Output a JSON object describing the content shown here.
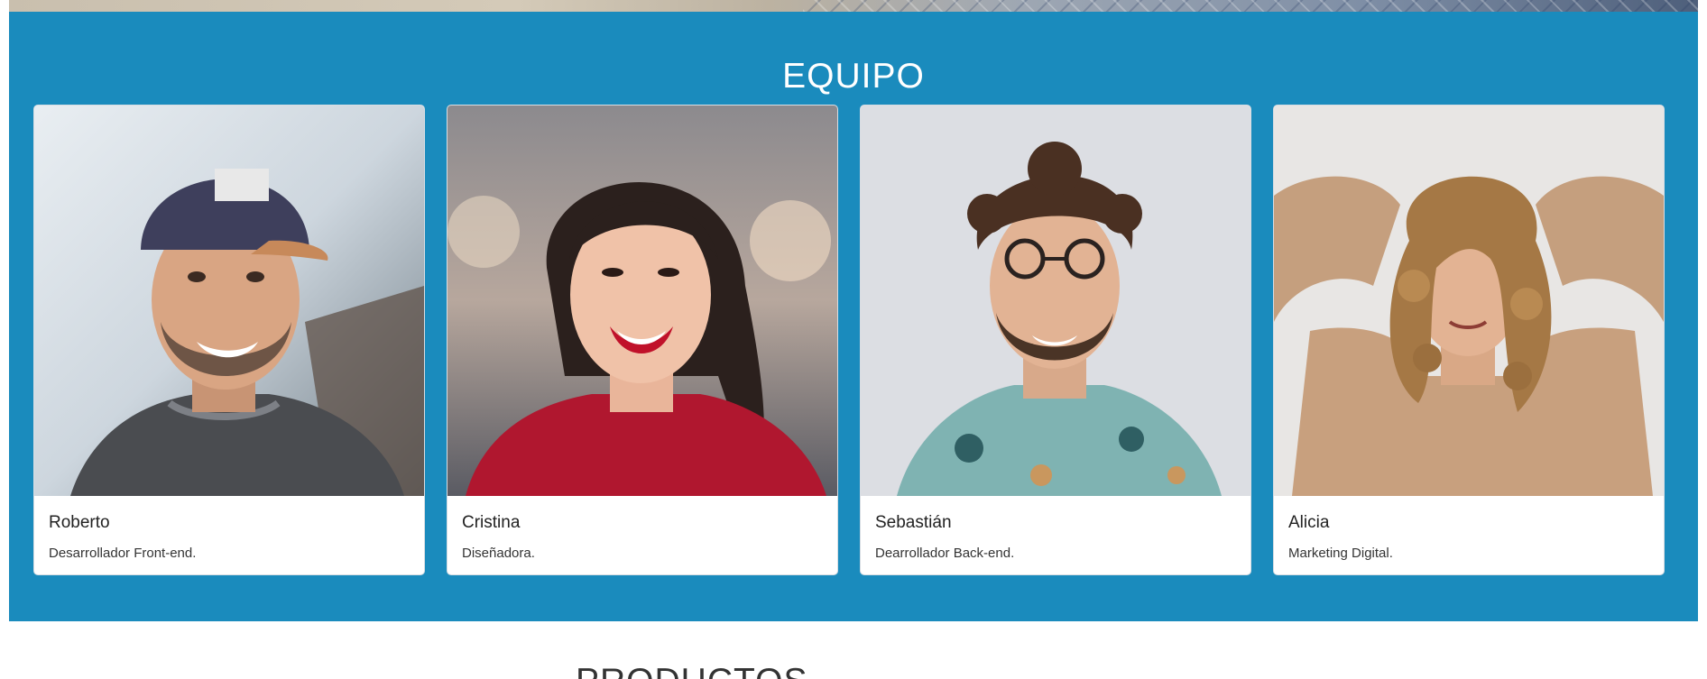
{
  "team": {
    "title": "EQUIPO",
    "members": [
      {
        "name": "Roberto",
        "role": "Desarrollador Front-end.",
        "photo": "portrait-man-cap"
      },
      {
        "name": "Cristina",
        "role": "Diseñadora.",
        "photo": "portrait-woman-smiling"
      },
      {
        "name": "Sebastián",
        "role": "Dearrollador Back-end.",
        "photo": "portrait-man-glasses"
      },
      {
        "name": "Alicia",
        "role": "Marketing Digital.",
        "photo": "portrait-woman-curly-hair"
      }
    ]
  },
  "products": {
    "title": "PRODUCTOS"
  },
  "colors": {
    "section_bg": "#1a8bbd",
    "card_bg": "#ffffff",
    "title": "#ffffff"
  }
}
